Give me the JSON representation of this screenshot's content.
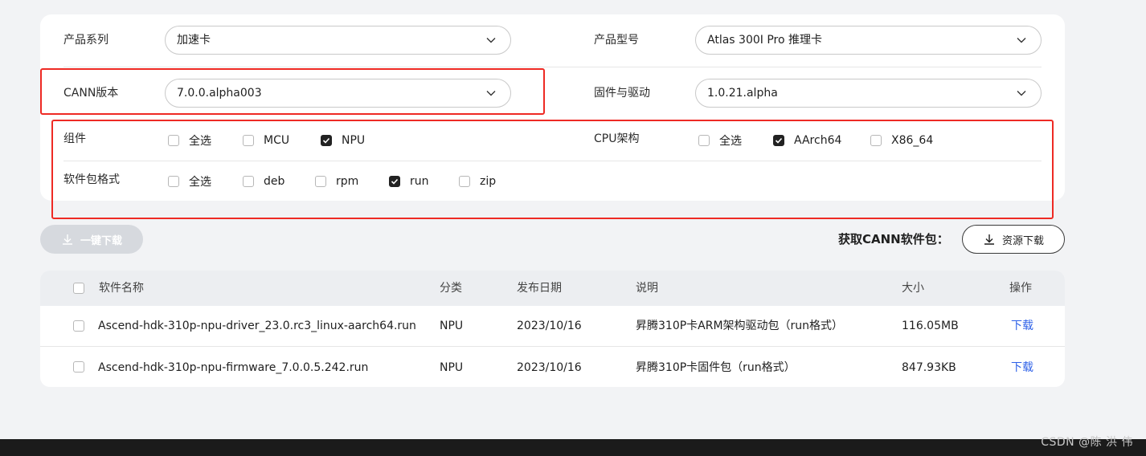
{
  "filters": {
    "product_series": {
      "label": "产品系列",
      "value": "加速卡"
    },
    "product_model": {
      "label": "产品型号",
      "value": "Atlas 300I Pro 推理卡"
    },
    "cann_version": {
      "label": "CANN版本",
      "value": "7.0.0.alpha003"
    },
    "firmware_driver": {
      "label": "固件与驱动",
      "value": "1.0.21.alpha"
    },
    "component": {
      "label": "组件",
      "options": [
        {
          "label": "全选",
          "checked": false
        },
        {
          "label": "MCU",
          "checked": false
        },
        {
          "label": "NPU",
          "checked": true
        }
      ]
    },
    "cpu_arch": {
      "label": "CPU架构",
      "options": [
        {
          "label": "全选",
          "checked": false
        },
        {
          "label": "AArch64",
          "checked": true
        },
        {
          "label": "X86_64",
          "checked": false
        }
      ]
    },
    "package_format": {
      "label": "软件包格式",
      "options": [
        {
          "label": "全选",
          "checked": false
        },
        {
          "label": "deb",
          "checked": false
        },
        {
          "label": "rpm",
          "checked": false
        },
        {
          "label": "run",
          "checked": true
        },
        {
          "label": "zip",
          "checked": false
        }
      ]
    }
  },
  "actions": {
    "one_click_download": "一键下载",
    "get_cann_label": "获取CANN软件包：",
    "resource_download": "资源下载"
  },
  "table": {
    "headers": [
      "软件名称",
      "分类",
      "发布日期",
      "说明",
      "大小",
      "操作"
    ],
    "rows": [
      {
        "name": "Ascend-hdk-310p-npu-driver_23.0.rc3_linux-aarch64.run",
        "category": "NPU",
        "date": "2023/10/16",
        "desc": "昇腾310P卡ARM架构驱动包（run格式）",
        "size": "116.05MB",
        "action": "下载"
      },
      {
        "name": "Ascend-hdk-310p-npu-firmware_7.0.0.5.242.run",
        "category": "NPU",
        "date": "2023/10/16",
        "desc": "昇腾310P卡固件包（run格式）",
        "size": "847.93KB",
        "action": "下载"
      }
    ]
  },
  "watermark": "CSDN @陈 洪 伟",
  "colors": {
    "highlight_box": "#ee2a24",
    "link": "#2f62e8",
    "checked": "#222222"
  }
}
